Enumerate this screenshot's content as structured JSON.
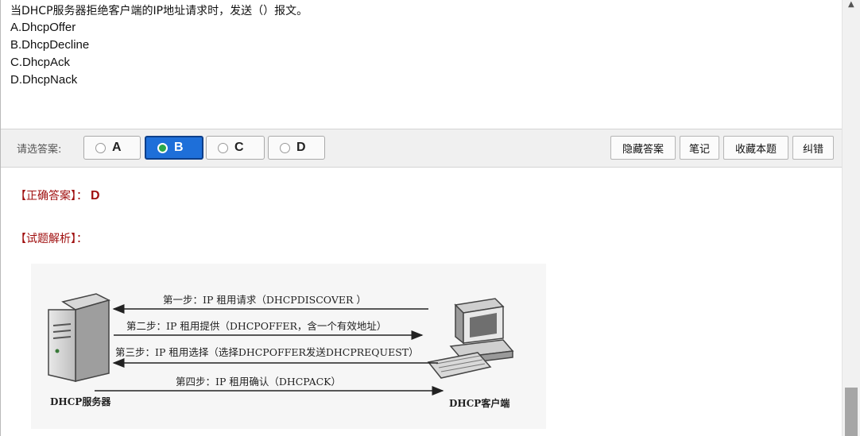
{
  "question": {
    "text": "当DHCP服务器拒绝客户端的IP地址请求时，发送（）报文。",
    "options": [
      "A.DhcpOffer",
      "B.DhcpDecline",
      "C.DhcpAck",
      "D.DhcpNack"
    ]
  },
  "answer_bar": {
    "prompt": "请选答案:",
    "choices": [
      "A",
      "B",
      "C",
      "D"
    ],
    "selected": "B",
    "tools": [
      "隐藏答案",
      "笔记",
      "收藏本题",
      "纠错"
    ]
  },
  "result": {
    "correct_label": "【正确答案】：",
    "correct_value": "D",
    "analysis_label": "【试题解析】："
  },
  "diagram": {
    "step1": "第一步：IP 租用请求（DHCPDISCOVER ）",
    "step2": "第二步：IP 租用提供（DHCPOFFER，含一个有效地址）",
    "step3": "第三步：IP 租用选择（选择DHCPOFFER发送DHCPREQUEST）",
    "step4": "第四步：IP 租用确认（DHCPACK）",
    "server_label": "DHCP服务器",
    "client_label": "DHCP客户端"
  },
  "scrollbar": {
    "up_arrow_icon": "up-arrow-icon"
  }
}
